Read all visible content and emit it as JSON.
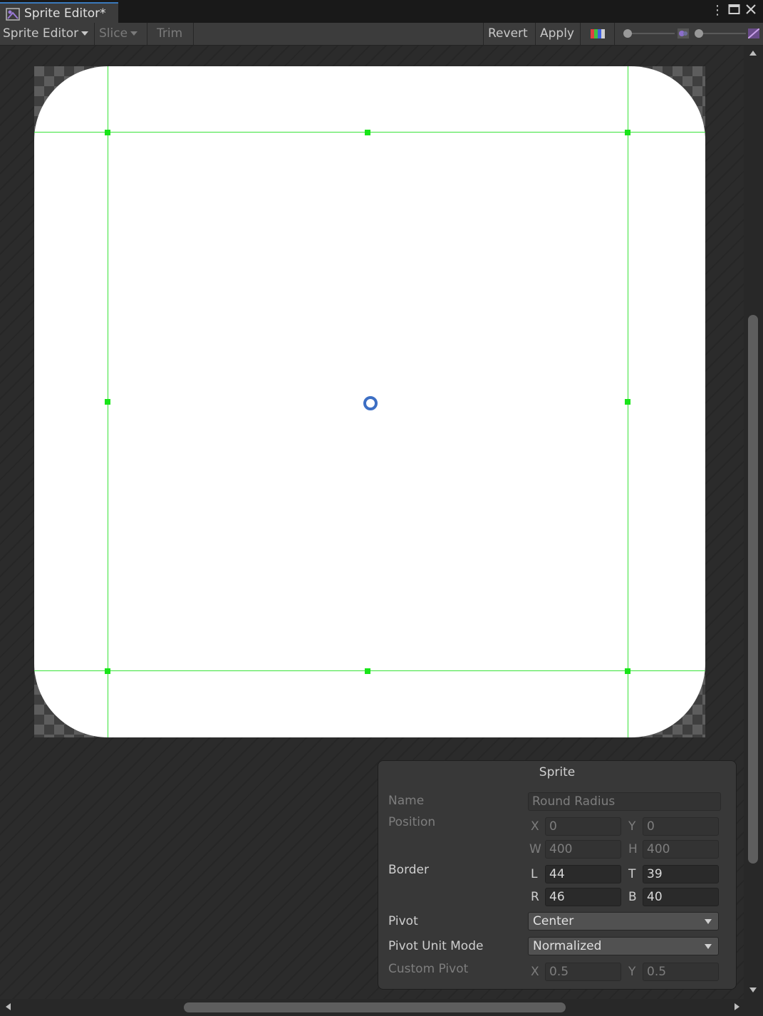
{
  "window": {
    "tab_title": "Sprite Editor*"
  },
  "toolbar": {
    "mode_label": "Sprite Editor",
    "slice_label": "Slice",
    "trim_label": "Trim",
    "revert_label": "Revert",
    "apply_label": "Apply"
  },
  "sprite_panel": {
    "title": "Sprite",
    "name_label": "Name",
    "name_value": "Round Radius",
    "position_label": "Position",
    "position": {
      "x_label": "X",
      "x": "0",
      "y_label": "Y",
      "y": "0",
      "w_label": "W",
      "w": "400",
      "h_label": "H",
      "h": "400"
    },
    "border_label": "Border",
    "border": {
      "l_label": "L",
      "l": "44",
      "t_label": "T",
      "t": "39",
      "r_label": "R",
      "r": "46",
      "b_label": "B",
      "b": "40"
    },
    "pivot_label": "Pivot",
    "pivot_value": "Center",
    "pivot_unit_mode_label": "Pivot Unit Mode",
    "pivot_unit_mode_value": "Normalized",
    "custom_pivot_label": "Custom Pivot",
    "custom_pivot": {
      "x_label": "X",
      "x": "0.5",
      "y_label": "Y",
      "y": "0.5"
    }
  },
  "colors": {
    "guide": "#39e339",
    "accent": "#3a79bb",
    "pivot": "#3d6fc4"
  }
}
